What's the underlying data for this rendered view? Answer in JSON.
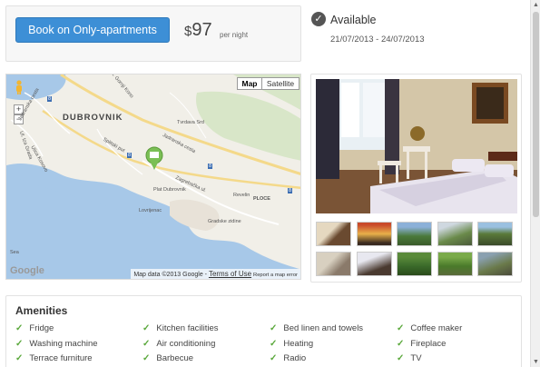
{
  "booking": {
    "button_label": "Book on Only-apartments",
    "currency": "$",
    "price": "97",
    "per_night": "per night"
  },
  "availability": {
    "label": "Available",
    "dates": "21/07/2013 - 24/07/2013",
    "icon": "check-circle-icon"
  },
  "map": {
    "map_toggle": "Map",
    "satellite_toggle": "Satellite",
    "zoom_in": "+",
    "zoom_out": "−",
    "city": "DUBROVNIK",
    "places": [
      "Tvrdava Srd",
      "Jadranska cesta",
      "Splitski put",
      "Zagrebačka ul.",
      "Plat Dubrovnik",
      "Lovrijenac",
      "Revelin",
      "PLOCE",
      "Gradske zidine",
      "Sea",
      "Ul. Gornji Kono",
      "Ul. Iza Grada",
      "Ulica Kosovo",
      "Jadranska cesta"
    ],
    "road_numbers": [
      "8",
      "8",
      "8",
      "8"
    ],
    "google": "Google",
    "map_data": "Map data ©2013 Google -",
    "terms": "Terms of Use",
    "report": "Report a map error"
  },
  "photos": {
    "thumbnail_count": 10
  },
  "amenities": {
    "title": "Amenities",
    "items": [
      "Fridge",
      "Kitchen facilities",
      "Bed linen and towels",
      "Coffee maker",
      "Washing machine",
      "Air conditioning",
      "Heating",
      "Fireplace",
      "Terrace furniture",
      "Barbecue",
      "Radio",
      "TV"
    ]
  },
  "scrollbar": {
    "up": "▲",
    "down": "▼"
  },
  "colors": {
    "button": "#3d8fd6",
    "check": "#5aa83b"
  }
}
